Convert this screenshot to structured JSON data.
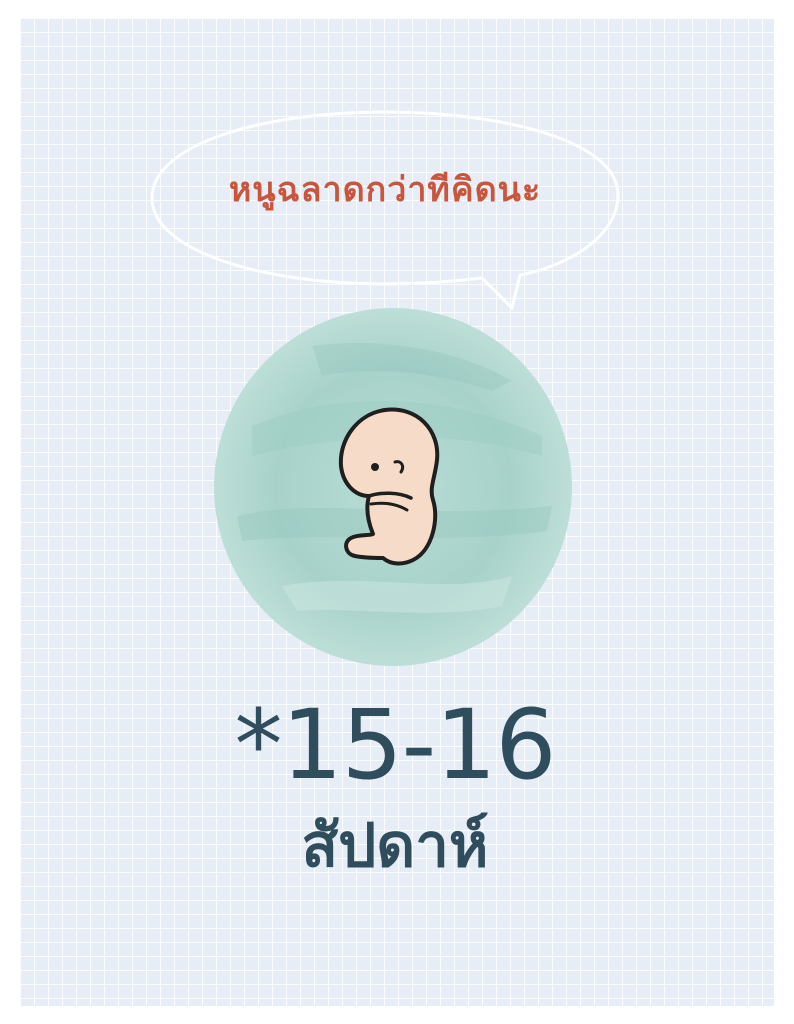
{
  "speech_bubble": {
    "text": "หนูฉลาดกว่าทีคิดนะ"
  },
  "headline": {
    "range": "*15-16",
    "unit": "สัปดาห์"
  },
  "colors": {
    "background": "#e6edf6",
    "grid": "#ffffff",
    "bubble_text": "#c9553c",
    "circle": "#a9d3cc",
    "headline": "#2f4d5c",
    "baby_skin": "#f6dcc8"
  },
  "icons": {
    "illustration": "fetus-icon",
    "circle": "watercolor-circle"
  }
}
